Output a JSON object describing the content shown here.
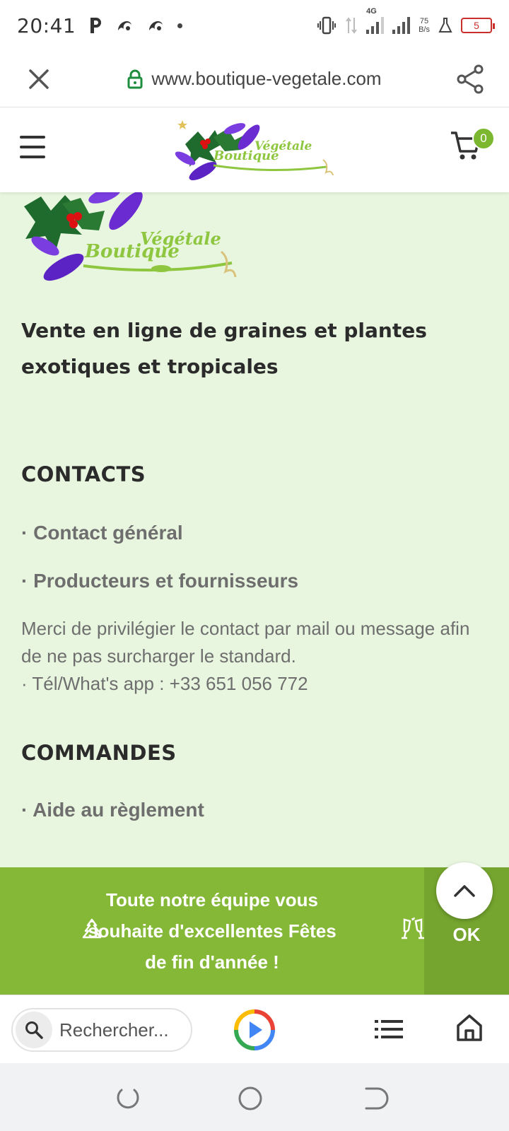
{
  "status_bar": {
    "time": "20:41",
    "network_type": "4G",
    "net_speed_value": "75",
    "net_speed_unit": "B/s",
    "battery_level": "5"
  },
  "browser": {
    "url": "www.boutique-vegetale.com"
  },
  "site_header": {
    "logo_word_1": "Boutique",
    "logo_word_2": "Végétale",
    "cart_count": "0"
  },
  "content": {
    "logo_word_1": "Boutique",
    "logo_word_2": "Végétale",
    "tagline": "Vente en ligne de graines et plantes exotiques et tropicales",
    "contacts_title": "CONTACTS",
    "contacts_links": [
      "· Contact général",
      "· Producteurs et fournisseurs"
    ],
    "contacts_note": "Merci de privilégier le contact par mail ou message afin de ne pas surcharger le standard.",
    "contacts_phone": "· Tél/What's app : +33 651 056 772",
    "orders_title": "COMMANDES",
    "orders_links": [
      "· Aide au règlement"
    ]
  },
  "promo_banner": {
    "message": "Toute notre équipe vous souhaite d'excellentes Fêtes de fin d'année !",
    "ok_label": "OK"
  },
  "bottom_toolbar": {
    "search_placeholder": "Rechercher..."
  },
  "colors": {
    "content_bg": "#e8f6df",
    "accent_green": "#86b838",
    "ok_green": "#75a52e",
    "badge_green": "#7cb82f",
    "lock_green": "#1e8e3e"
  },
  "icons": [
    "close-icon",
    "lock-icon",
    "share-icon",
    "menu-icon",
    "cart-icon",
    "scroll-top-icon",
    "search-icon",
    "play-icon",
    "list-icon",
    "home-icon",
    "recent-apps-icon",
    "home-circle-icon",
    "back-icon"
  ]
}
